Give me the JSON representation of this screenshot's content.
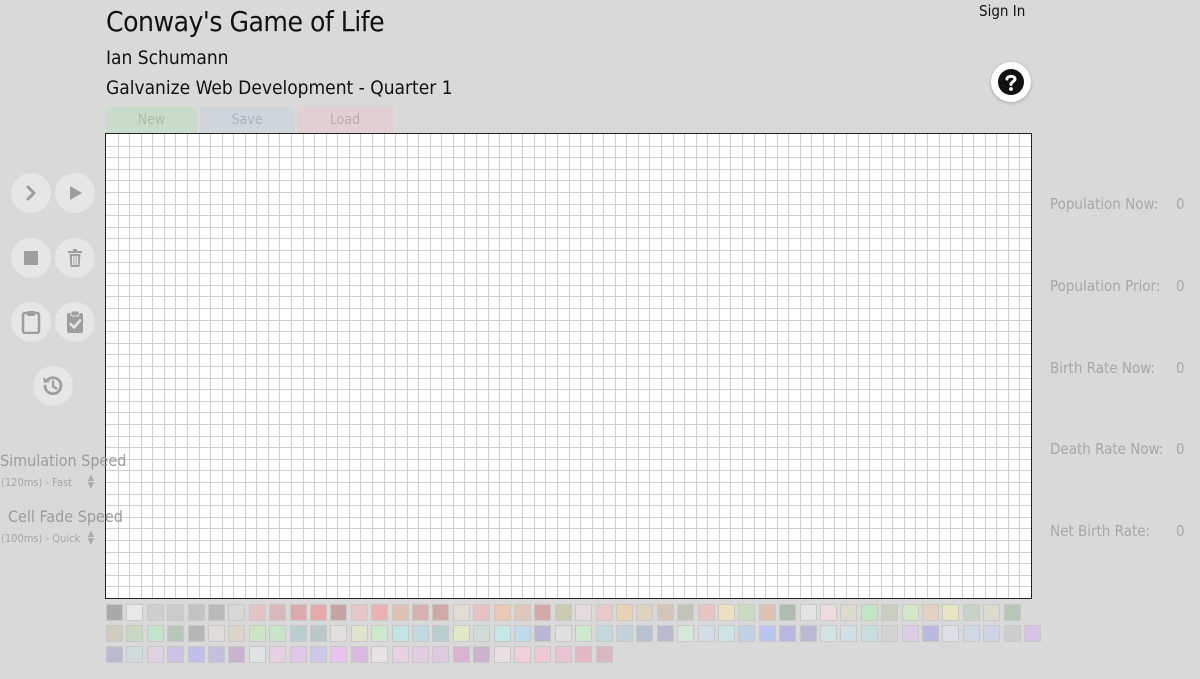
{
  "header": {
    "title": "Conway's Game of Life",
    "author": "Ian Schumann",
    "course": "Galvanize Web Development - Quarter 1",
    "sign_in": "Sign In"
  },
  "toolbar": {
    "new_label": "New",
    "save_label": "Save",
    "load_label": "Load"
  },
  "controls": {
    "icons": [
      "step-icon",
      "play-icon",
      "stop-icon",
      "trash-icon",
      "clipboard-icon",
      "clipboard-check-icon",
      "history-icon"
    ],
    "help_icon": "question-circle-icon"
  },
  "settings": {
    "simulation_speed_label": "Simulation Speed",
    "simulation_speed_value": "(120ms) - Fast",
    "cell_fade_label": "Cell Fade Speed",
    "cell_fade_value": "(100ms) - Quick"
  },
  "stats": [
    {
      "label": "Population Now:",
      "value": "0"
    },
    {
      "label": "Population Prior:",
      "value": "0"
    },
    {
      "label": "Birth Rate Now:",
      "value": "0"
    },
    {
      "label": "Death Rate Now:",
      "value": "0"
    },
    {
      "label": "Net Birth Rate:",
      "value": "0"
    }
  ],
  "grid": {
    "cols": 80,
    "rows": 40
  },
  "palette": [
    "#a9a9a9",
    "#e8e8e8",
    "#cfcfcf",
    "#cbcbcb",
    "#c3c3c3",
    "#b9b9b9",
    "#d8d8d8",
    "#e3c3c3",
    "#d9b9b9",
    "#dcaaaa",
    "#e5a9a9",
    "#c7a4a4",
    "#e6c7c7",
    "#e9b3b3",
    "#dcc0b3",
    "#d8b0b0",
    "#cfa8a8",
    "#e1dcd3",
    "#e8c2c2",
    "#e9c9b5",
    "#dfc7bd",
    "#d6a9a9",
    "#ccc9b3",
    "#e4dcdc",
    "#eac9c9",
    "#e9d3b5",
    "#dfd3c0",
    "#d3c5b9",
    "#c2c4b9",
    "#e8c4c4",
    "#ebe1c0",
    "#c9dcc3",
    "#dcc0b3",
    "#afbfaf",
    "#e3e3e3",
    "#eedcdc",
    "#dbdbcd",
    "#c3e7c3",
    "#c9cfc0",
    "#d3e6c9",
    "#e3d1c3",
    "#e6e6c3",
    "#c6d3c6",
    "#dbdbcd",
    "#b7c7b7",
    "#d2ccc0",
    "#c9d8c0",
    "#c3e4cc",
    "#b7c7b7",
    "#b7b7b7",
    "#dfdbdb",
    "#dcd3c9",
    "#cde4c3",
    "#c9e4c9",
    "#b9cfcf",
    "#b9c9c9",
    "#e3dfdf",
    "#e0e4cd",
    "#cce7cc",
    "#c3e4e4",
    "#c0d9e0",
    "#b9cdcd",
    "#e0e8c7",
    "#cfdcd3",
    "#c3e7e7",
    "#c0dbe7",
    "#b7b7d3",
    "#dfdfdf",
    "#cfe7cf",
    "#c3d9d9",
    "#c3d3d9",
    "#b9c0cf",
    "#b9b9cd",
    "#d8e8d8",
    "#d3dde7",
    "#cde3e3",
    "#c0d3e4",
    "#b9c4f0",
    "#b7b7e4",
    "#b9b9d3",
    "#d3e3e3",
    "#d0dfe3",
    "#c7dfdf",
    "#d3d3d3",
    "#dccde7",
    "#b9b9e4",
    "#dfdfe7",
    "#cfd8e3",
    "#cfd3e7",
    "#cdcdcd",
    "#d7c3e7",
    "#b9b9cf",
    "#d0dcdc",
    "#dfd3e3",
    "#cdc3e7",
    "#c0c0ec",
    "#c6c0e0",
    "#c9b3cf",
    "#dfe3e3",
    "#e7d0e3",
    "#e0c7e7",
    "#cfc7e7",
    "#e9c3ef",
    "#d9b9e0",
    "#e7e3e3",
    "#e7d0e0",
    "#e3cde0",
    "#dfc9df",
    "#d9b3cf",
    "#cfb3cc",
    "#e9dfe3",
    "#efcfd9",
    "#ecc9d3",
    "#e7c3d3",
    "#e3b7c3",
    "#d9b9c0"
  ]
}
